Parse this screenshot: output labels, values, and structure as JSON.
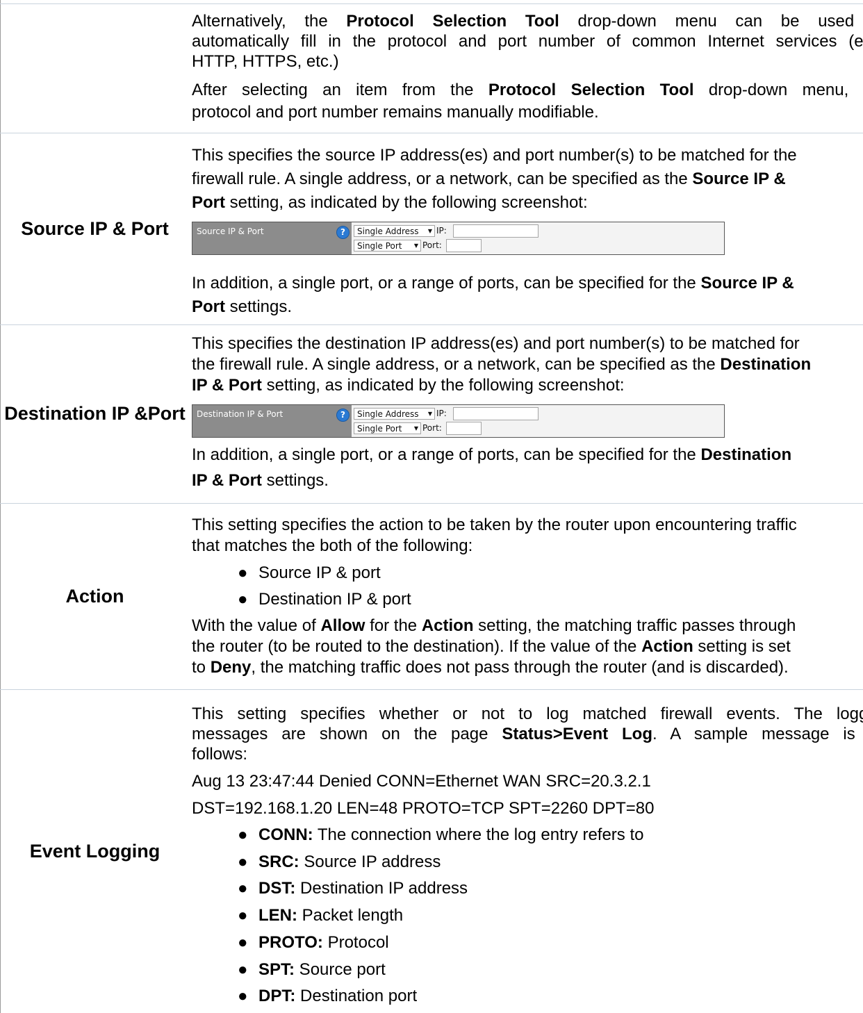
{
  "rows": [
    {
      "label": "",
      "p1": [
        [
          "Alternatively, the ",
          "Protocol Selection Tool",
          " drop-down menu can be used to"
        ],
        [
          "automatically fill in the protocol and port number of common Internet services (e.g.,"
        ],
        [
          "HTTP, HTTPS, etc.)"
        ]
      ],
      "p2": [
        [
          "After selecting an item from the ",
          "Protocol Selection Tool",
          " drop-down menu, the"
        ],
        [
          "protocol and port number remains manually modifiable."
        ]
      ]
    },
    {
      "label": "Source IP & Port",
      "p1": [
        [
          "This specifies the source IP address(es) and port number(s) to be matched for the"
        ],
        [
          "firewall rule. A single address, or a network, can be specified as the ",
          "Source IP &"
        ],
        [
          "",
          "Port",
          " setting, as indicated by the following screenshot:"
        ]
      ],
      "p2": [
        [
          "In addition, a single port, or a range of ports, can be specified for the ",
          "Source IP &"
        ],
        [
          "",
          "Port",
          " settings."
        ]
      ],
      "screenshot": {
        "label": "Source IP & Port",
        "help": "?",
        "address_select": "Single Address",
        "ip_label": "IP:",
        "port_select": "Single Port",
        "port_label": "Port:"
      }
    },
    {
      "label": "Destination IP & Port",
      "label_lines": [
        "Destination IP &",
        "Port"
      ],
      "p1": [
        [
          "This specifies the destination IP address(es) and port number(s) to be matched for"
        ],
        [
          "the firewall rule. A single address, or a network, can be specified as the ",
          "Destination"
        ],
        [
          "",
          "IP & Port",
          " setting, as indicated by the following screenshot:"
        ]
      ],
      "p2": [
        [
          "In addition, a single port, or a range of ports, can be specified for the ",
          "Destination"
        ],
        [
          "",
          "IP & Port",
          " settings."
        ]
      ],
      "screenshot": {
        "label": "Destination IP & Port",
        "help": "?",
        "address_select": "Single Address",
        "ip_label": "IP:",
        "port_select": "Single Port",
        "port_label": "Port:"
      }
    },
    {
      "label": "Action",
      "p1": [
        [
          "This setting specifies the action to be taken by the router upon encountering traffic"
        ],
        [
          "that matches the both of the following:"
        ]
      ],
      "bullets": [
        "Source IP & port",
        "Destination IP & port"
      ],
      "p2": [
        [
          "With the value of ",
          "Allow",
          " for the ",
          "Action",
          " setting, the matching traffic passes through"
        ],
        [
          "the router (to be routed to the destination). If the value of the ",
          "Action",
          " setting is set"
        ],
        [
          "to ",
          "Deny",
          ", the matching traffic does not pass through the router (and is discarded)."
        ]
      ]
    },
    {
      "label": "Event Logging",
      "p1": [
        [
          "This setting specifies whether or not to log matched firewall events. The logged"
        ],
        [
          "messages are shown on the page ",
          "Status>Event Log",
          ". A sample message is as"
        ],
        [
          "follows:"
        ]
      ],
      "sample": [
        "Aug 13 23:47:44 Denied CONN=Ethernet WAN SRC=20.3.2.1",
        "DST=192.168.1.20 LEN=48 PROTO=TCP SPT=2260 DPT=80"
      ],
      "bullets": [
        {
          "key": "CONN:",
          "desc": "The connection where the log entry refers to"
        },
        {
          "key": "SRC:",
          "desc": "Source IP address"
        },
        {
          "key": "DST:",
          "desc": "Destination IP address"
        },
        {
          "key": "LEN:",
          "desc": "Packet length"
        },
        {
          "key": "PROTO:",
          "desc": "Protocol"
        },
        {
          "key": "SPT:",
          "desc": "Source port"
        },
        {
          "key": "DPT:",
          "desc": "Destination port"
        }
      ]
    }
  ],
  "bullet_glyph": "●"
}
